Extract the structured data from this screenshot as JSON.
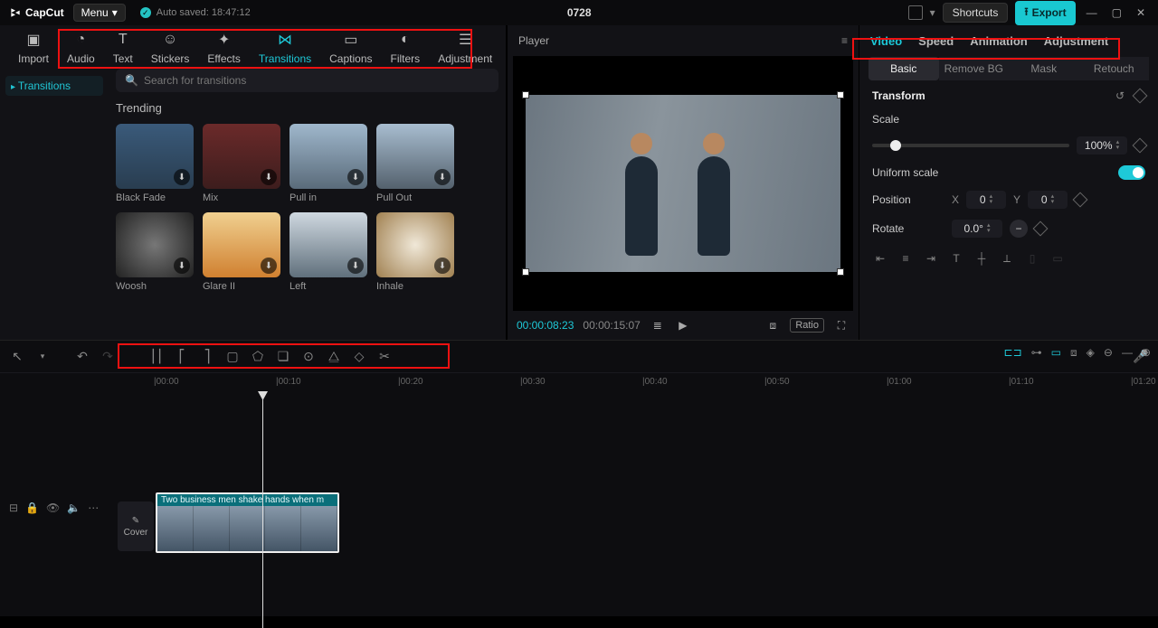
{
  "titlebar": {
    "logo": "CapCut",
    "menu": "Menu",
    "autosave": "Auto saved: 18:47:12",
    "project": "0728",
    "shortcuts": "Shortcuts",
    "export": "Export"
  },
  "tools": {
    "import": "Import",
    "audio": "Audio",
    "text": "Text",
    "stickers": "Stickers",
    "effects": "Effects",
    "transitions": "Transitions",
    "captions": "Captions",
    "filters": "Filters",
    "adjustment": "Adjustment"
  },
  "side": {
    "transitions": "Transitions"
  },
  "search": {
    "placeholder": "Search for transitions"
  },
  "section": {
    "trending": "Trending"
  },
  "thumbs": {
    "t1": "Black Fade",
    "t2": "Mix",
    "t3": "Pull in",
    "t4": "Pull Out",
    "t5": "Woosh",
    "t6": "Glare II",
    "t7": "Left",
    "t8": "Inhale"
  },
  "player": {
    "title": "Player",
    "cur": "00:00:08:23",
    "dur": "00:00:15:07",
    "ratio": "Ratio"
  },
  "rp": {
    "tabs": {
      "video": "Video",
      "speed": "Speed",
      "animation": "Animation",
      "adjustment": "Adjustment"
    },
    "sub": {
      "basic": "Basic",
      "removebg": "Remove BG",
      "mask": "Mask",
      "retouch": "Retouch"
    },
    "transform": "Transform",
    "scale": "Scale",
    "scale_val": "100%",
    "uniform": "Uniform scale",
    "position": "Position",
    "x": "X",
    "xval": "0",
    "y": "Y",
    "yval": "0",
    "rotate": "Rotate",
    "rotate_val": "0.0°"
  },
  "timeline": {
    "cover": "Cover",
    "clip": "Two business men shake hands when m",
    "ticks": {
      "t0": "|00:00",
      "t10": "|00:10",
      "t20": "|00:20",
      "t30": "|00:30",
      "t40": "|00:40",
      "t50": "|00:50",
      "t60": "|01:00",
      "t70": "|01:10",
      "t80": "|01:20"
    }
  }
}
